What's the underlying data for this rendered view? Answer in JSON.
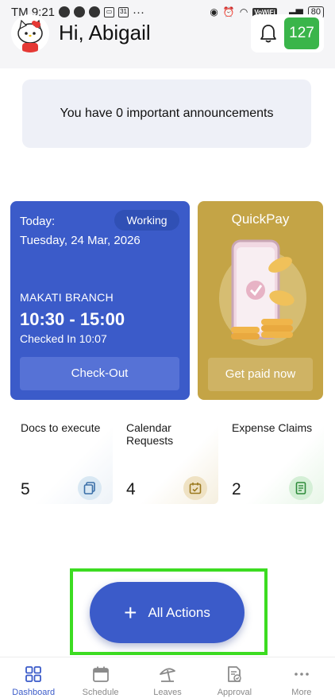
{
  "status_bar": {
    "time": "TM 9:21",
    "calendar_day": "31",
    "more_dots": "···",
    "network": "VoWiFi",
    "battery": "80"
  },
  "header": {
    "greeting": "Hi, Abigail",
    "notification_count": "127"
  },
  "announcement": {
    "text": "You have 0 important announcements"
  },
  "today_card": {
    "label": "Today:",
    "status": "Working",
    "date": "Tuesday, 24 Mar, 2026",
    "branch": "MAKATI BRANCH",
    "shift": "10:30 - 15:00",
    "checked_in": "Checked In 10:07",
    "button": "Check-Out"
  },
  "quickpay_card": {
    "title": "QuickPay",
    "button": "Get paid now"
  },
  "tiles": [
    {
      "title": "Docs to execute",
      "count": "5",
      "icon": "copy-docs-icon"
    },
    {
      "title": "Calendar Requests",
      "count": "4",
      "icon": "calendar-check-icon"
    },
    {
      "title": "Expense Claims",
      "count": "2",
      "icon": "receipt-icon"
    }
  ],
  "all_actions": {
    "label": "All Actions"
  },
  "bottom_nav": [
    {
      "label": "Dashboard",
      "icon": "dashboard-grid-icon",
      "active": true
    },
    {
      "label": "Schedule",
      "icon": "calendar-icon",
      "active": false
    },
    {
      "label": "Leaves",
      "icon": "beach-umbrella-icon",
      "active": false
    },
    {
      "label": "Approval",
      "icon": "approval-doc-icon",
      "active": false
    },
    {
      "label": "More",
      "icon": "more-dots-icon",
      "active": false
    }
  ],
  "colors": {
    "primary": "#3b5bc9",
    "quickpay": "#c4a446",
    "badge_green": "#3ab54a",
    "highlight_frame": "#3cdc21"
  }
}
